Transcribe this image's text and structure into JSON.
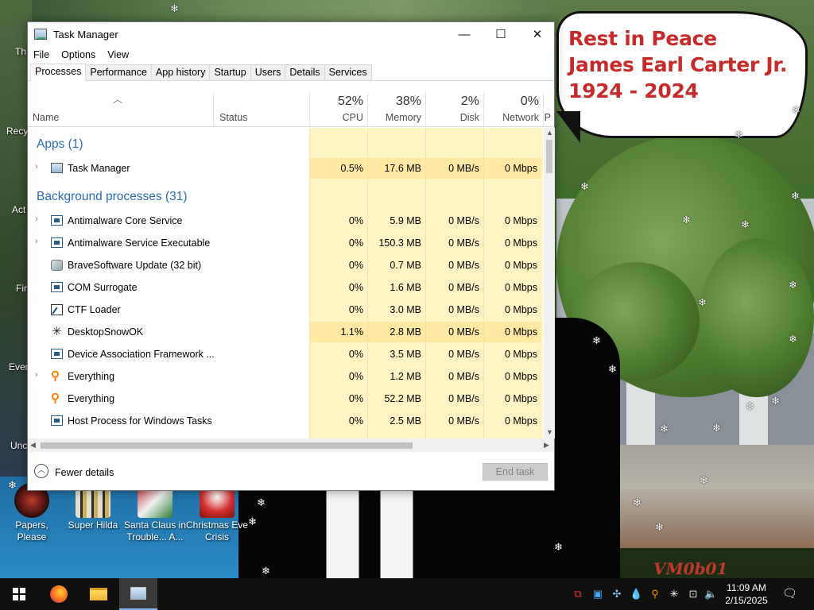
{
  "wallpaper": {
    "bubble_lines": [
      "Rest in Peace",
      "James Earl Carter Jr.",
      "1924 - 2024"
    ],
    "signature": "VM0b01"
  },
  "desktop_icons": [
    {
      "name": "desktop-icon-papers-please",
      "label": "Papers, Please"
    },
    {
      "name": "desktop-icon-super-hilda",
      "label": "Super Hilda"
    },
    {
      "name": "desktop-icon-santa-claus",
      "label": "Santa Claus in Trouble... A..."
    },
    {
      "name": "desktop-icon-christmas-eve",
      "label": "Christmas Eve Crisis"
    }
  ],
  "edge_labels": [
    "Th",
    "Recy",
    "Act",
    "Fir",
    "Ever",
    "Unc"
  ],
  "window": {
    "title": "Task Manager",
    "menu": [
      "File",
      "Options",
      "View"
    ],
    "tabs": [
      "Processes",
      "Performance",
      "App history",
      "Startup",
      "Users",
      "Details",
      "Services"
    ],
    "active_tab": "Processes",
    "controls": {
      "minimize": "—",
      "maximize": "☐",
      "close": "✕"
    }
  },
  "columns": {
    "name": "Name",
    "status": "Status",
    "cpu": {
      "pct": "52%",
      "label": "CPU"
    },
    "memory": {
      "pct": "38%",
      "label": "Memory"
    },
    "disk": {
      "pct": "2%",
      "label": "Disk"
    },
    "network": {
      "pct": "0%",
      "label": "Network"
    },
    "extra": "P"
  },
  "groups": {
    "apps": "Apps (1)",
    "background": "Background processes (31)"
  },
  "apps": [
    {
      "name": "Task Manager",
      "icon": "task-manager-icon",
      "cpu": "0.5%",
      "memory": "17.6 MB",
      "disk": "0 MB/s",
      "network": "0 Mbps",
      "expandable": true
    }
  ],
  "processes": [
    {
      "name": "Antimalware Core Service",
      "icon": "service-icon",
      "cpu": "0%",
      "memory": "5.9 MB",
      "disk": "0 MB/s",
      "network": "0 Mbps",
      "expandable": true
    },
    {
      "name": "Antimalware Service Executable",
      "icon": "service-icon",
      "cpu": "0%",
      "memory": "150.3 MB",
      "disk": "0 MB/s",
      "network": "0 Mbps",
      "expandable": true
    },
    {
      "name": "BraveSoftware Update (32 bit)",
      "icon": "updater-icon",
      "cpu": "0%",
      "memory": "0.7 MB",
      "disk": "0 MB/s",
      "network": "0 Mbps",
      "expandable": false
    },
    {
      "name": "COM Surrogate",
      "icon": "service-icon",
      "cpu": "0%",
      "memory": "1.6 MB",
      "disk": "0 MB/s",
      "network": "0 Mbps",
      "expandable": false
    },
    {
      "name": "CTF Loader",
      "icon": "ctf-loader-icon",
      "cpu": "0%",
      "memory": "3.0 MB",
      "disk": "0 MB/s",
      "network": "0 Mbps",
      "expandable": false
    },
    {
      "name": "DesktopSnowOK",
      "icon": "snowflake-icon",
      "cpu": "1.1%",
      "memory": "2.8 MB",
      "disk": "0 MB/s",
      "network": "0 Mbps",
      "expandable": false
    },
    {
      "name": "Device Association Framework ...",
      "icon": "service-icon",
      "cpu": "0%",
      "memory": "3.5 MB",
      "disk": "0 MB/s",
      "network": "0 Mbps",
      "expandable": false
    },
    {
      "name": "Everything",
      "icon": "everything-search-icon",
      "cpu": "0%",
      "memory": "1.2 MB",
      "disk": "0 MB/s",
      "network": "0 Mbps",
      "expandable": true
    },
    {
      "name": "Everything",
      "icon": "everything-search-icon",
      "cpu": "0%",
      "memory": "52.2 MB",
      "disk": "0 MB/s",
      "network": "0 Mbps",
      "expandable": false
    },
    {
      "name": "Host Process for Windows Tasks",
      "icon": "service-icon",
      "cpu": "0%",
      "memory": "2.5 MB",
      "disk": "0 MB/s",
      "network": "0 Mbps",
      "expandable": false
    }
  ],
  "footer": {
    "fewer_details": "Fewer details",
    "end_task": "End task"
  },
  "taskbar": {
    "time": "11:09 AM",
    "date": "2/15/2025",
    "apps": [
      "start-button",
      "firefox-taskbar-icon",
      "file-explorer-taskbar-icon",
      "task-manager-taskbar-icon"
    ]
  },
  "colors": {
    "accent_blue": "#2a6bb5",
    "heat_light": "#fff4c4",
    "heat_medium": "#ffe9a3",
    "bubble_text": "#c62a2a",
    "taskbar": "#101010"
  }
}
